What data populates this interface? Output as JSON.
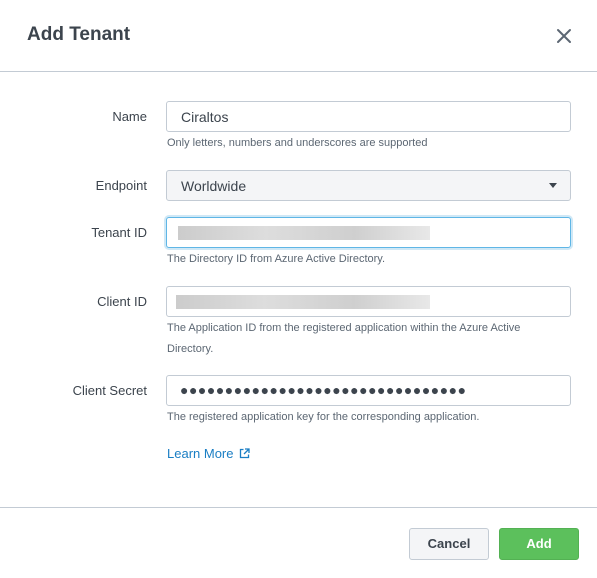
{
  "dialog": {
    "title": "Add Tenant",
    "close_icon": "close-icon"
  },
  "form": {
    "name": {
      "label": "Name",
      "value": "Ciraltos",
      "help": "Only letters, numbers and underscores are supported"
    },
    "endpoint": {
      "label": "Endpoint",
      "value": "Worldwide",
      "caret_icon": "caret-down-icon"
    },
    "tenant_id": {
      "label": "Tenant ID",
      "help": "The Directory ID from Azure Active Directory."
    },
    "client_id": {
      "label": "Client ID",
      "help_line1": "The Application ID from the registered application within the Azure Active",
      "help_line2": "Directory."
    },
    "client_secret": {
      "label": "Client Secret",
      "value": "●●●●●●●●●●●●●●●●●●●●●●●●●●●●●●●●",
      "help": "The registered application key for the corresponding application."
    },
    "learn_more": {
      "label": "Learn More",
      "icon": "external-link-icon"
    }
  },
  "footer": {
    "cancel_label": "Cancel",
    "add_label": "Add"
  },
  "colors": {
    "accent_link": "#1a7ec4",
    "primary_button": "#5cc05c",
    "focus_border": "#5fb6e6"
  }
}
